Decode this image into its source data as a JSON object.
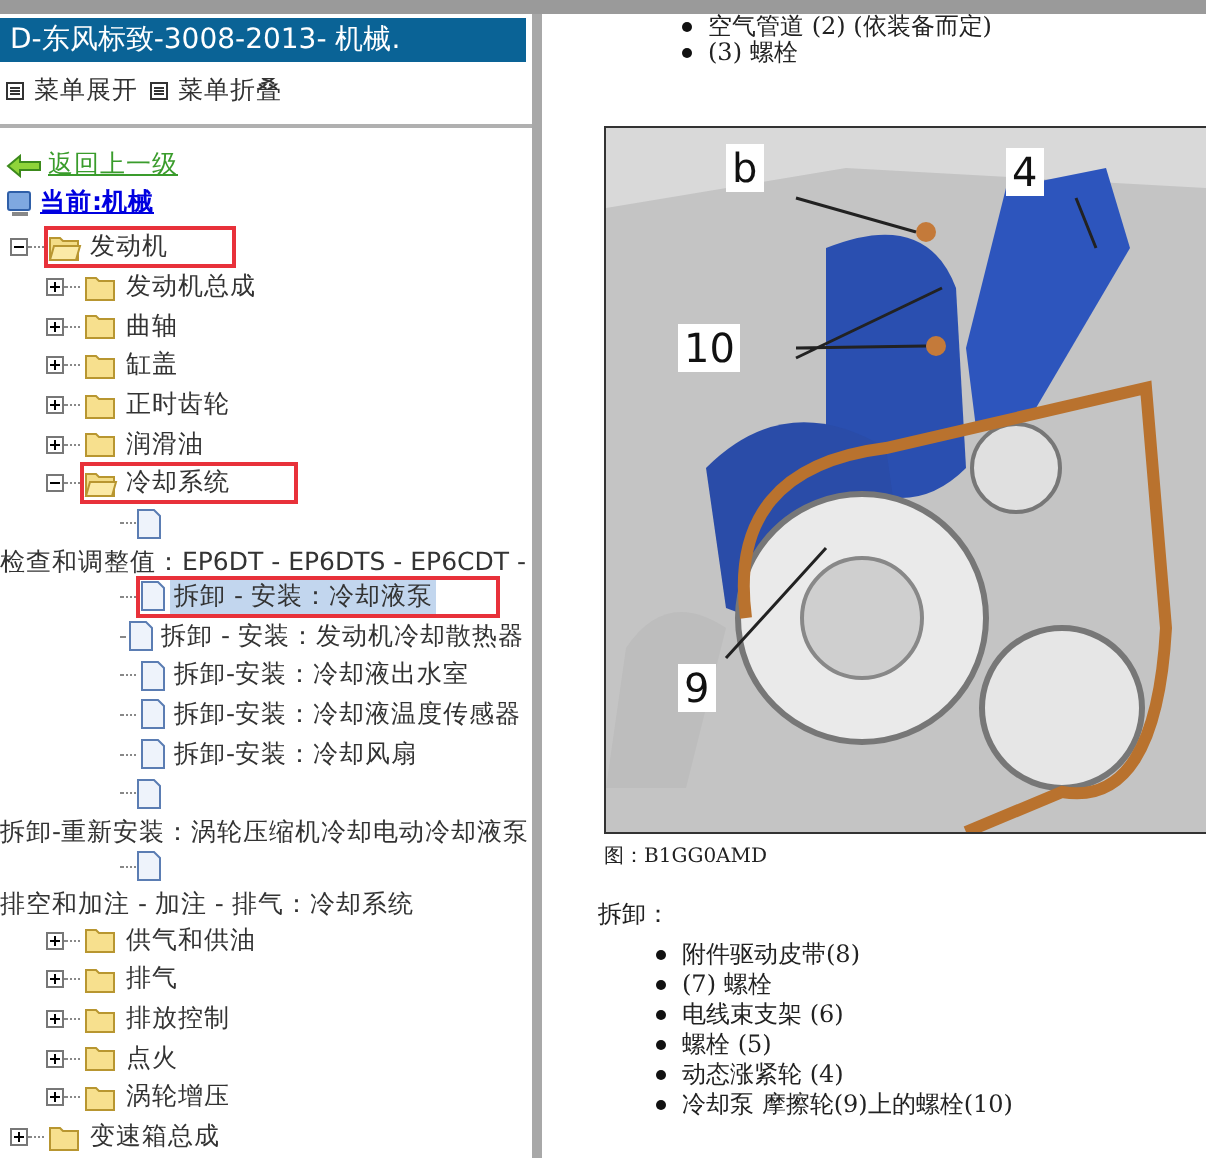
{
  "sidebar": {
    "title": "D-东风标致-3008-2013- 机械.",
    "menu": [
      {
        "label": "菜单展开"
      },
      {
        "label": "菜单折叠"
      }
    ],
    "back_link": "返回上一级",
    "current": "当前:机械",
    "tree": [
      {
        "kind": "folder",
        "label": "发动机",
        "expanded": true,
        "highlighted": true,
        "children": [
          {
            "kind": "folder",
            "label": "发动机总成",
            "expanded": false,
            "highlighted": false
          },
          {
            "kind": "folder",
            "label": "曲轴",
            "expanded": false,
            "highlighted": false
          },
          {
            "kind": "folder",
            "label": "缸盖",
            "expanded": false,
            "highlighted": false
          },
          {
            "kind": "folder",
            "label": "正时齿轮",
            "expanded": false,
            "highlighted": false
          },
          {
            "kind": "folder",
            "label": "润滑油",
            "expanded": false,
            "highlighted": false
          },
          {
            "kind": "folder",
            "label": "冷却系统",
            "expanded": true,
            "highlighted": true,
            "children": [
              {
                "kind": "doc"
              },
              {
                "kind": "note",
                "label": "检查和调整值：EP6DT - EP6DTS - EP6CDT -"
              },
              {
                "kind": "doc",
                "label": "拆卸 - 安装：冷却液泵",
                "selected": true,
                "highlighted": true
              },
              {
                "kind": "doc",
                "label": "拆卸 - 安装：发动机冷却散热器",
                "selected": false,
                "highlighted": false
              },
              {
                "kind": "doc",
                "label": "拆卸-安装：冷却液出水室",
                "selected": false,
                "highlighted": false
              },
              {
                "kind": "doc",
                "label": "拆卸-安装：冷却液温度传感器",
                "selected": false,
                "highlighted": false
              },
              {
                "kind": "doc",
                "label": "拆卸-安装：冷却风扇",
                "selected": false,
                "highlighted": false
              },
              {
                "kind": "doc"
              },
              {
                "kind": "note",
                "label": "拆卸-重新安装：涡轮压缩机冷却电动冷却液泵"
              },
              {
                "kind": "doc"
              },
              {
                "kind": "note",
                "label": "排空和加注 - 加注 - 排气：冷却系统"
              }
            ]
          },
          {
            "kind": "folder",
            "label": "供气和供油",
            "expanded": false,
            "highlighted": false
          },
          {
            "kind": "folder",
            "label": "排气",
            "expanded": false,
            "highlighted": false
          },
          {
            "kind": "folder",
            "label": "排放控制",
            "expanded": false,
            "highlighted": false
          },
          {
            "kind": "folder",
            "label": "点火",
            "expanded": false,
            "highlighted": false
          },
          {
            "kind": "folder",
            "label": "涡轮增压",
            "expanded": false,
            "highlighted": false
          }
        ]
      },
      {
        "kind": "folder",
        "label": "变速箱总成",
        "expanded": false,
        "highlighted": false
      }
    ]
  },
  "document": {
    "top_items": [
      "空气管道 (2) (依装备而定)",
      "(3) 螺栓"
    ],
    "figure": {
      "callouts": [
        "b",
        "4",
        "10",
        "9"
      ],
      "caption": "图：B1GG0AMD"
    },
    "section_title": "拆卸：",
    "steps": [
      "附件驱动皮带(8)",
      "(7) 螺栓",
      "电线束支架 (6)",
      "螺栓 (5)",
      "动态涨紧轮 (4)",
      "冷却泵 摩擦轮(9)上的螺栓(10)"
    ]
  }
}
